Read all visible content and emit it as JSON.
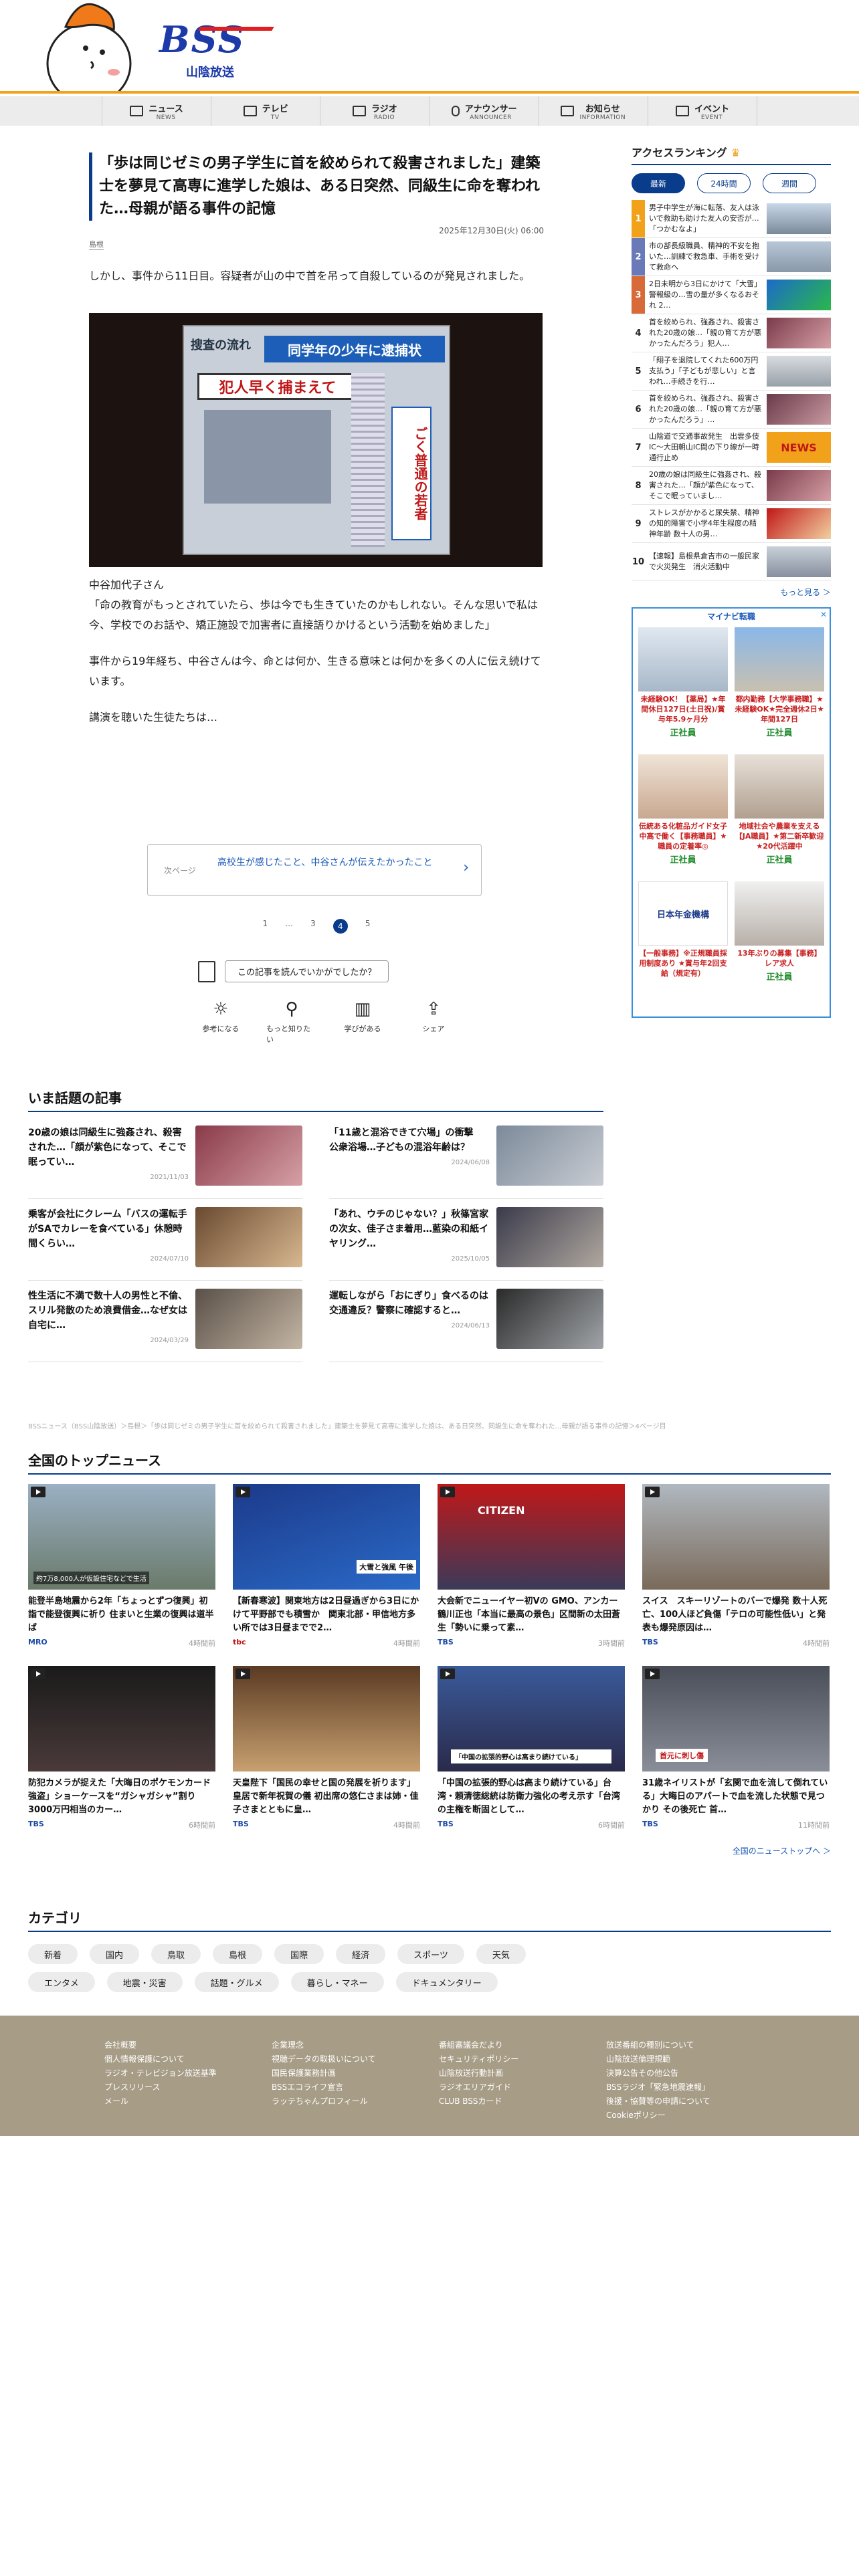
{
  "header": {
    "logo_text": "BSS",
    "logo_sub": "山陰放送"
  },
  "nav": [
    {
      "jp": "ニュース",
      "en": "NEWS"
    },
    {
      "jp": "テレビ",
      "en": "TV"
    },
    {
      "jp": "ラジオ",
      "en": "RADIO"
    },
    {
      "jp": "アナウンサー",
      "en": "ANNOUNCER"
    },
    {
      "jp": "お知らせ",
      "en": "INFORMATION"
    },
    {
      "jp": "イベント",
      "en": "EVENT"
    }
  ],
  "article": {
    "title": "「歩は同じゼミの男子学生に首を絞められて殺害されました」建築士を夢見て高専に進学した娘は、ある日突然、同級生に命を奪われた…母親が語る事件の記憶",
    "date": "2025年12月30日(火) 06:00",
    "tag": "島根",
    "p1": "しかし、事件から11日目。容疑者が山の中で首を吊って自殺しているのが発見されました。",
    "poster_heading": "同学年の少年に逮捕状",
    "poster_left": "搜査の流れ",
    "poster_red": "犯人早く捕まえて",
    "poster_right": "ごく普通の若者",
    "caption": "中谷加代子さん",
    "p2": "「命の教育がもっとされていたら、歩は今でも生きていたのかもしれない。そんな思いで私は今、学校でのお話や、矯正施設で加害者に直接語りかけるという活動を始めました」",
    "p3": "事件から19年経ち、中谷さんは今、命とは何か、生きる意味とは何かを多くの人に伝え続けています。",
    "p4": "講演を聴いた生徒たちは…",
    "next_label": "次ページ",
    "next_title": "高校生が感じたこと、中谷さんが伝えたかったこと",
    "pages": [
      "1",
      "…",
      "3",
      "4",
      "5"
    ],
    "current_page": "4",
    "feedback_q": "この記事を読んでいかがでしたか？",
    "feedback": [
      "参考になる",
      "もっと知りたい",
      "学びがある",
      "シェア"
    ]
  },
  "trending": {
    "heading": "いま話題の記事",
    "items": [
      {
        "title": "20歳の娘は同級生に強姦され、殺害された…「顔が紫色になって、そこで眠ってい…",
        "date": "2021/11/03"
      },
      {
        "title": "「11歳と混浴できて穴場」の衝撃　公衆浴場…子どもの混浴年齢は？",
        "date": "2024/06/08"
      },
      {
        "title": "乗客が会社にクレーム「バスの運転手がSAでカレーを食べている」休憩時間くらい…",
        "date": "2024/07/10"
      },
      {
        "title": "「あれ、ウチのじゃない？」秋篠宮家の次女、佳子さま着用…藍染の和紙イヤリング…",
        "date": "2025/10/05"
      },
      {
        "title": "性生活に不満で数十人の男性と不倫、スリル発散のため浪費借金…なぜ女は自宅に…",
        "date": "2024/03/29"
      },
      {
        "title": "運転しながら「おにぎり」食べるのは交通違反？警察に確認すると…",
        "date": "2024/06/13"
      }
    ]
  },
  "breadcrumb": "BSSニュース（BSS山陰放送）＞島根＞「歩は同じゼミの男子学生に首を絞められて殺害されました」建築士を夢見て高専に進学した娘は、ある日突然、同級生に命を奪われた…母親が語る事件の記憶＞4ページ目",
  "top_news": {
    "heading": "全国のトップニュース",
    "more": "全国のニューストップへ ＞",
    "items": [
      {
        "title": "能登半島地震から2年「ちょっとずつ復興」初詣で能登復興に祈り 住まいと生業の復興は道半ば",
        "src": "MRO",
        "time": "4時間前",
        "overlay": "約7万8,000人が仮設住宅などで生活"
      },
      {
        "title": "【新春寒波】関東地方は2日昼過ぎから3日にかけて平野部でも積雪か　関東北部・甲信地方多い所では3日昼までで2…",
        "src": "tbc",
        "time": "4時間前",
        "overlay": "大雪と強風 午後"
      },
      {
        "title": "大会新でニューイヤー初Vの GMO、アンカー鶴川正也「本当に最高の景色」区間新の太田蒼生「勢いに乗って素…",
        "src": "TBS",
        "time": "3時間前",
        "overlay": "CITIZEN"
      },
      {
        "title": "スイス　スキーリゾートのバーで爆発 数十人死亡、100人ほど負傷「テロの可能性低い」と発表も爆発原因は…",
        "src": "TBS",
        "time": "4時間前",
        "overlay": ""
      },
      {
        "title": "防犯カメラが捉えた「大晦日のポケモンカード強盗」ショーケースを“ガシャガシャ”割り3000万円相当のカー…",
        "src": "TBS",
        "time": "6時間前",
        "overlay": ""
      },
      {
        "title": "天皇陛下「国民の幸せと国の発展を祈ります」皇居で新年祝賀の儀 初出席の悠仁さまは姉・佳子さまとともに皇…",
        "src": "TBS",
        "time": "4時間前",
        "overlay": ""
      },
      {
        "title": "「中国の拡張的野心は高まり続けている」台湾・頼清徳総統は防衛力強化の考え示す「台湾の主権を断固として…",
        "src": "TBS",
        "time": "6時間前",
        "overlay": "「中国の拡張的野心は高まり続けている」"
      },
      {
        "title": "31歳ネイリストが「玄関で血を流して倒れている」大晦日のアパートで血を流した状態で見つかり その後死亡 首…",
        "src": "TBS",
        "time": "11時間前",
        "overlay": "首元に刺し傷"
      }
    ]
  },
  "categories": {
    "heading": "カテゴリ",
    "items": [
      "新着",
      "国内",
      "鳥取",
      "島根",
      "国際",
      "経済",
      "スポーツ",
      "天気",
      "エンタメ",
      "地震・災害",
      "話題・グルメ",
      "暮らし・マネー",
      "ドキュメンタリー"
    ]
  },
  "ranking": {
    "heading": "アクセスランキング",
    "tabs": [
      "最新",
      "24時間",
      "週間"
    ],
    "more": "もっと見る ＞",
    "items": [
      {
        "no": "1",
        "title": "男子中学生が海に転落、友人は泳いで救助も助けた友人の安否が…「つかむなよ」",
        "color": "#f2a21a"
      },
      {
        "no": "2",
        "title": "市の部長級職員、精神的不安を抱いた…訓練で救急車、手術を受けて救命へ",
        "color": "#f2a21a"
      },
      {
        "no": "3",
        "title": "2日未明から3日にかけて「大雪」警報級の…雪の量が多くなるおそれ 2…",
        "color": "#f2a21a"
      },
      {
        "no": "4",
        "title": "首を絞められ、強姦され、殺害された20歳の娘…「親の育て方が悪かったんだろう」犯人…",
        "color": "#fff"
      },
      {
        "no": "5",
        "title": "「翔子を退院してくれた600万円支払う」「子どもが悲しい」と言われ…手続きを行…",
        "color": "#fff"
      },
      {
        "no": "6",
        "title": "首を絞められ、強姦され、殺害された20歳の娘…「親の育て方が悪かったんだろう」…",
        "color": "#fff"
      },
      {
        "no": "7",
        "title": "山陰道で交通事故発生　出雲多伎IC〜大田朝山IC間の下り線が一時通行止め",
        "color": "#fff"
      },
      {
        "no": "8",
        "title": "20歳の娘は同級生に強姦され、殺害された…「顔が紫色になって、そこで眠っていまし…",
        "color": "#fff"
      },
      {
        "no": "9",
        "title": "ストレスがかかると尿失禁、精神の知的障害で小学4年生程度の精神年齢 数十人の男…",
        "color": "#fff"
      },
      {
        "no": "10",
        "title": "【速報】島根県倉吉市の一般民家で火災発生　消火活動中",
        "color": "#fff"
      }
    ]
  },
  "ad": {
    "brand": "マイナビ転職",
    "cells": [
      {
        "text": "未経験OK！【薬局】★年間休日127日(土日祝)/賞与年5.9ヶ月分",
        "sub": "正社員"
      },
      {
        "text": "都内勤務【大学事務職】★未経験OK★完全週休2日★年間127日",
        "sub": "正社員"
      },
      {
        "text": "伝統ある化粧品ガイド女子中高で働く【事務職員】★職員の定着率◎",
        "sub": "正社員"
      },
      {
        "text": "地域社会や農業を支える【JA職員】★第二新卒歓迎★20代活躍中",
        "sub": "正社員"
      },
      {
        "text": "【一般事務】※正規職員採用制度あり ★賞与年2回支給（規定有）",
        "sub": "日本年金機構"
      },
      {
        "text": "13年ぶりの募集【事務】レア求人",
        "sub": "正社員"
      }
    ]
  },
  "footer": {
    "col1": [
      "会社概要",
      "個人情報保護について",
      "ラジオ・テレビジョン放送基準",
      "プレスリリース",
      "メール"
    ],
    "col2": [
      "企業理念",
      "視聴データの取扱いについて",
      "国民保護業務計画",
      "BSSエコライフ宣言",
      "ラッテちゃんプロフィール"
    ],
    "col3": [
      "番組審議会だより",
      "セキュリティポリシー",
      "山陰放送行動計画",
      "ラジオエリアガイド",
      "CLUB BSSカード"
    ],
    "col4": [
      "放送番組の種別について",
      "山陰放送倫理規範",
      "決算公告その他公告",
      "BSSラジオ「緊急地震速報」",
      "後援・協賛等の申請について",
      "Cookieポリシー"
    ]
  },
  "colors": {
    "brand_blue": "#0a3c8c",
    "accent_orange": "#f2a21a",
    "footer_bg": "#a79c86"
  }
}
